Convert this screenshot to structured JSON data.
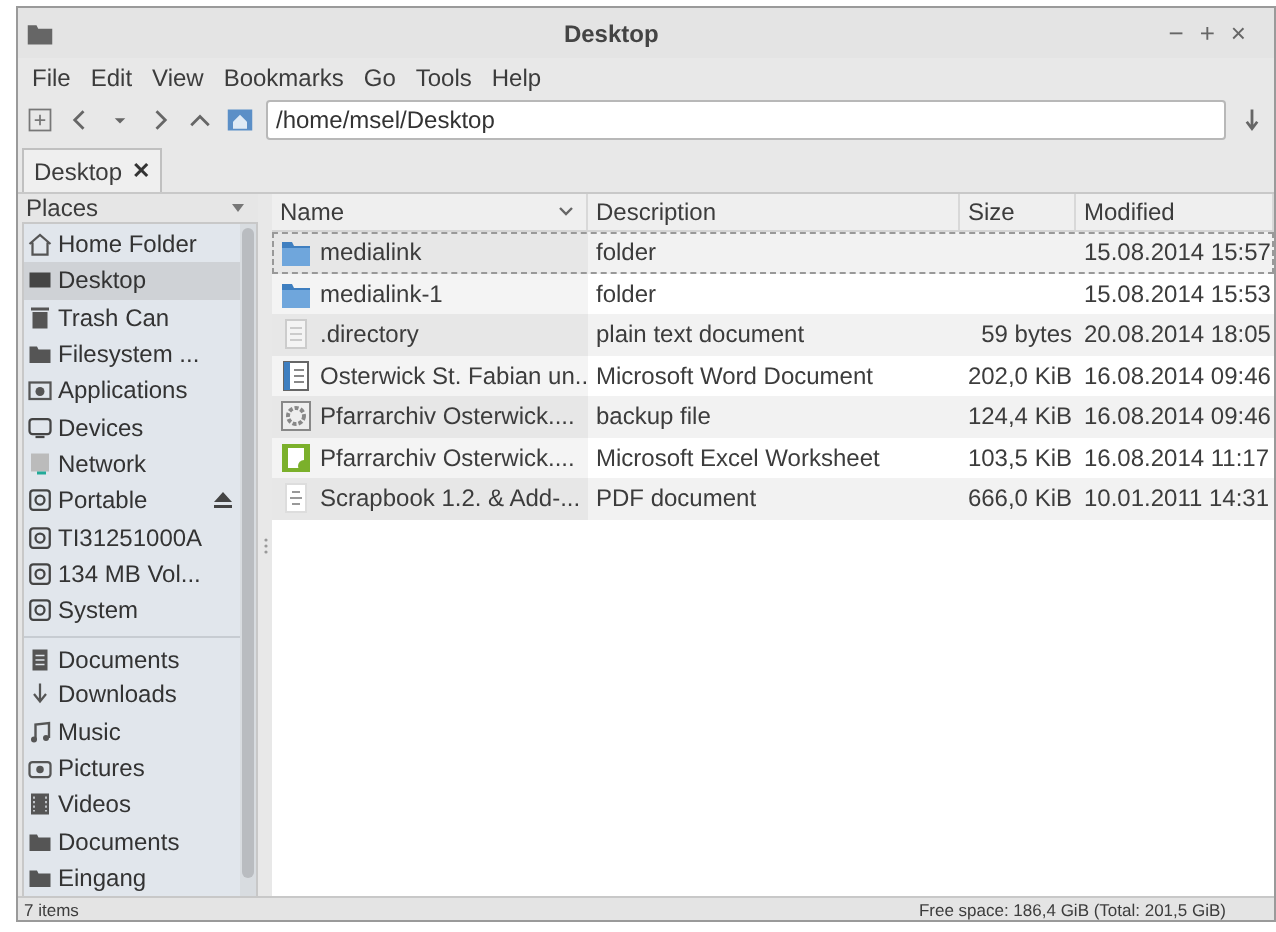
{
  "window": {
    "title": "Desktop",
    "controls": [
      "−",
      "+",
      "×"
    ]
  },
  "menu": [
    "File",
    "Edit",
    "View",
    "Bookmarks",
    "Go",
    "Tools",
    "Help"
  ],
  "location": {
    "value": "/home/msel/Desktop"
  },
  "tabs": [
    {
      "label": "Desktop",
      "close": "✕",
      "selected": true
    }
  ],
  "sidebar": {
    "title": "Places",
    "items": [
      {
        "label": "Home Folder",
        "kind": "home",
        "selected": false
      },
      {
        "label": "Desktop",
        "kind": "desktop",
        "selected": true
      },
      {
        "label": "Trash Can",
        "kind": "trash",
        "selected": false
      },
      {
        "label": "Filesystem ...",
        "kind": "folder",
        "selected": false
      },
      {
        "label": "Applications",
        "kind": "apps",
        "selected": false
      },
      {
        "label": "Devices",
        "kind": "monitor",
        "selected": false
      },
      {
        "label": "Network",
        "kind": "network",
        "selected": false
      },
      {
        "label": "Portable",
        "kind": "drive",
        "selected": false,
        "eject": true
      },
      {
        "label": "TI31251000A",
        "kind": "drive",
        "selected": false
      },
      {
        "label": "134 MB Vol...",
        "kind": "drive",
        "selected": false
      },
      {
        "label": "System",
        "kind": "drive",
        "selected": false
      },
      {
        "label": "Documents",
        "kind": "document",
        "selected": false
      },
      {
        "label": "Downloads",
        "kind": "download",
        "selected": false
      },
      {
        "label": "Music",
        "kind": "music",
        "selected": false
      },
      {
        "label": "Pictures",
        "kind": "camera",
        "selected": false
      },
      {
        "label": "Videos",
        "kind": "film",
        "selected": false
      },
      {
        "label": "Documents",
        "kind": "folder",
        "selected": false
      },
      {
        "label": "Eingang",
        "kind": "folder",
        "selected": false
      }
    ]
  },
  "table": {
    "columns": [
      "Name",
      "Description",
      "Size",
      "Modified"
    ],
    "rows": [
      {
        "kind": "folder",
        "name": "medialink",
        "description": "folder",
        "modified": "15.08.2014 15:57",
        "focused": true
      },
      {
        "kind": "folder",
        "name": "medialink-1",
        "description": "folder",
        "modified": "15.08.2014 15:53",
        "focused": false
      },
      {
        "kind": "text",
        "name": ".directory",
        "description": "plain text document",
        "size": "59 bytes",
        "modified": "20.08.2014 18:05",
        "focused": false
      },
      {
        "kind": "word",
        "name": "Osterwick St. Fabian un...",
        "description": "Microsoft Word Document",
        "size": "202,0 KiB",
        "modified": "16.08.2014 09:46",
        "focused": false
      },
      {
        "kind": "backup",
        "name": "Pfarrarchiv Osterwick....",
        "description": "backup file",
        "size": "124,4 KiB",
        "modified": "16.08.2014 09:46",
        "focused": false
      },
      {
        "kind": "excel",
        "name": "Pfarrarchiv Osterwick....",
        "description": "Microsoft Excel Worksheet",
        "size": "103,5 KiB",
        "modified": "16.08.2014 11:17",
        "focused": false
      },
      {
        "kind": "pdf",
        "name": "Scrapbook 1.2. & Add-...",
        "description": "PDF document",
        "size": "666,0 KiB",
        "modified": "10.01.2011 14:31",
        "focused": false
      }
    ]
  },
  "status_bar": {
    "left": "7 items",
    "right": "Free space: 186,4 GiB (Total: 201,5 GiB)"
  }
}
